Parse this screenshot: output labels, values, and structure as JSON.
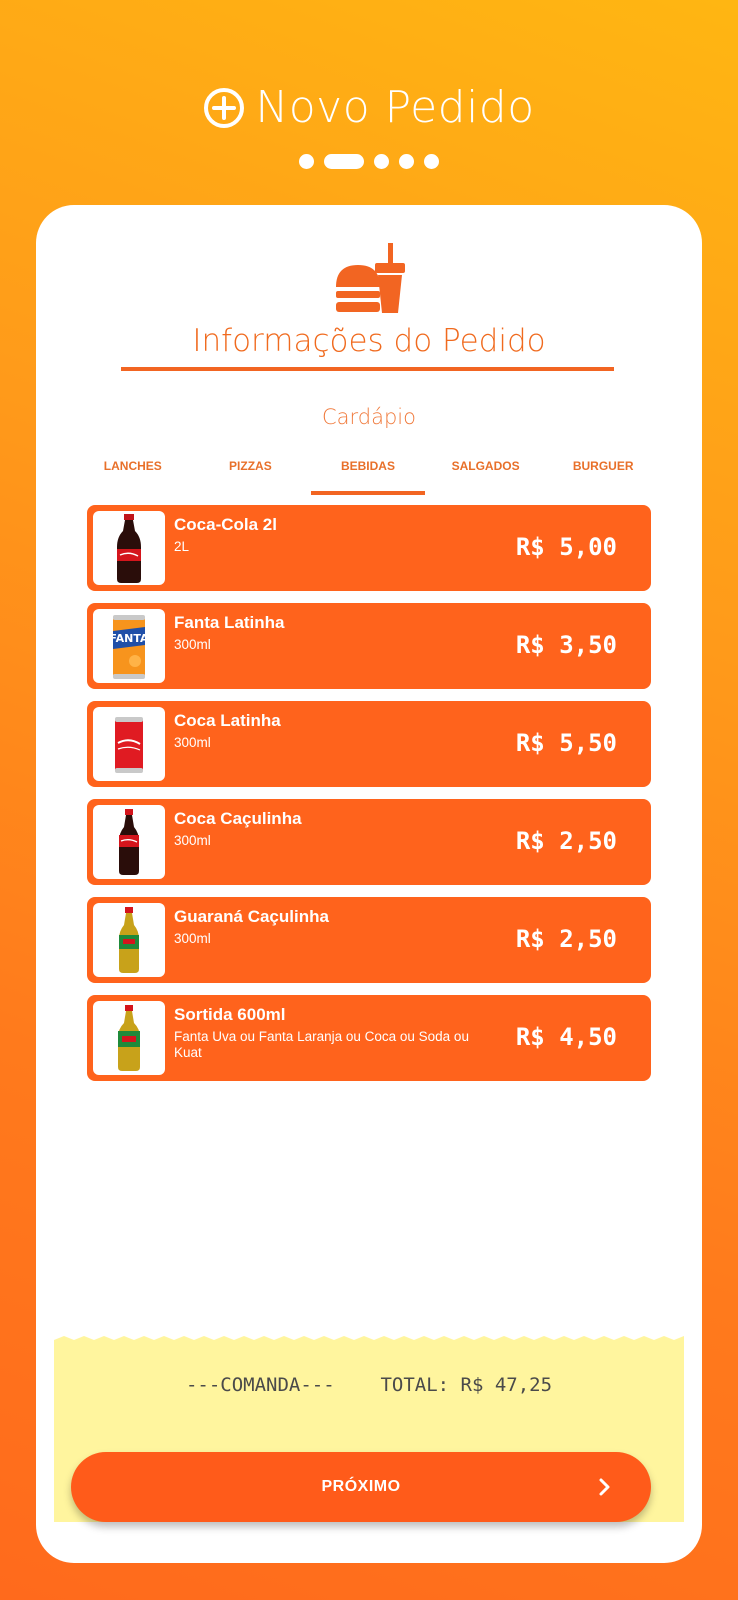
{
  "header": {
    "title": "Novo Pedido",
    "icon": "plus-circle-icon"
  },
  "steps": {
    "total": 5,
    "active": 2
  },
  "card": {
    "title": "Informações do Pedido",
    "icon": "burger-drink-icon",
    "menu_title": "Cardápio"
  },
  "tabs": [
    {
      "label": "LANCHES"
    },
    {
      "label": "PIZZAS"
    },
    {
      "label": "BEBIDAS",
      "active": true
    },
    {
      "label": "SALGADOS"
    },
    {
      "label": "BURGUER"
    }
  ],
  "items": [
    {
      "name": "Coca-Cola 2l",
      "desc": "2L",
      "price": "R$ 5,00",
      "image": "coca-cola-bottle"
    },
    {
      "name": "Fanta Latinha",
      "desc": "300ml",
      "price": "R$ 3,50",
      "image": "fanta-can"
    },
    {
      "name": "Coca Latinha",
      "desc": "300ml",
      "price": "R$ 5,50",
      "image": "coca-can"
    },
    {
      "name": "Coca Caçulinha",
      "desc": "300ml",
      "price": "R$ 2,50",
      "image": "coca-small-bottle"
    },
    {
      "name": "Guaraná Caçulinha",
      "desc": "300ml",
      "price": "R$ 2,50",
      "image": "guarana-small-bottle"
    },
    {
      "name": "Sortida 600ml",
      "desc": "Fanta Uva ou Fanta Laranja ou Coca ou Soda ou Kuat",
      "price": "R$ 4,50",
      "image": "guarana-bottle"
    }
  ],
  "receipt": {
    "label": "---COMANDA---",
    "total": "TOTAL: R$ 47,25"
  },
  "next_button": {
    "label": "PRÓXIMO",
    "icon": "chevron-right-icon"
  },
  "colors": {
    "primary": "#ff631c",
    "gradient_top": "#ffb612",
    "receipt_bg": "#fff59e"
  }
}
